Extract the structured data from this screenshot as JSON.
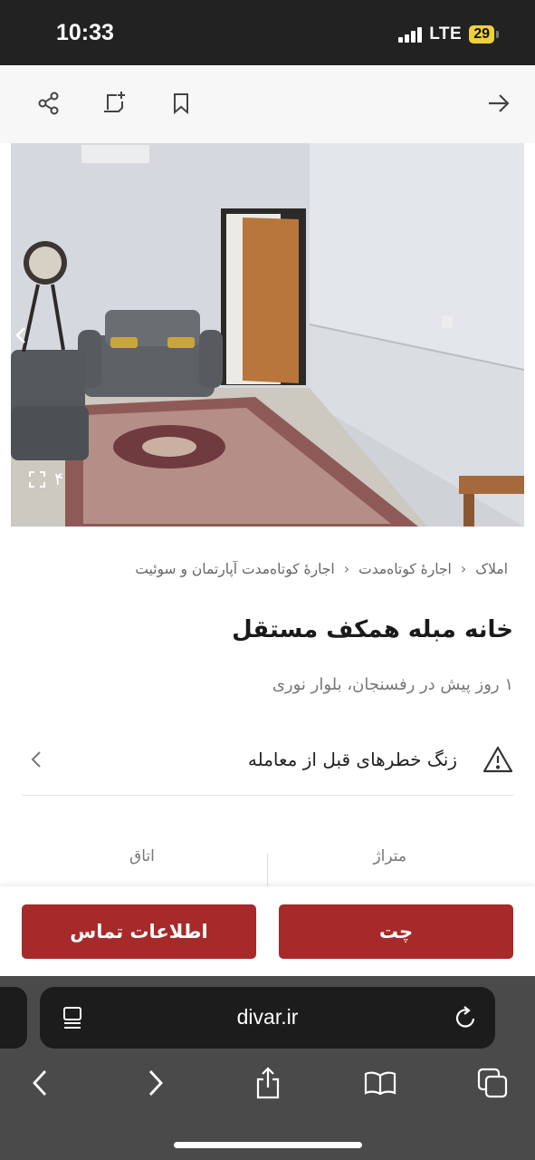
{
  "status_bar": {
    "time": "10:33",
    "network": "LTE",
    "battery": "29",
    "colors": {
      "background": "#222222",
      "battery": "#f0d03a"
    }
  },
  "toolbar": {
    "icons": [
      "share-icon",
      "add-note-icon",
      "bookmark-icon",
      "back-arrow-icon"
    ]
  },
  "gallery": {
    "photo_count": "۴",
    "icons": [
      "chevron-left-icon",
      "fullscreen-icon"
    ]
  },
  "breadcrumb": {
    "items": [
      "املاک",
      "اجارهٔ کوتاه‌مدت",
      "اجارهٔ کوتاه‌مدت آپارتمان و سوئیت"
    ]
  },
  "listing": {
    "title": "خانه مبله همکف مستقل",
    "subtitle": "۱ روز پیش در رفسنجان، بلوار نوری"
  },
  "warning": {
    "text": "زنگ خطرهای قبل از معامله",
    "icons": [
      "warning-icon",
      "chevron-left-icon"
    ]
  },
  "attributes": {
    "headers": [
      "متراژ",
      "اتاق"
    ]
  },
  "actions": {
    "chat_label": "چت",
    "contact_label": "اطلاعات تماس",
    "color": "#a62a2a"
  },
  "browser": {
    "url": "divar.ir",
    "icons": [
      "reader-icon",
      "reload-icon",
      "back-icon",
      "forward-icon",
      "share-icon",
      "bookmarks-icon",
      "tabs-icon"
    ]
  }
}
